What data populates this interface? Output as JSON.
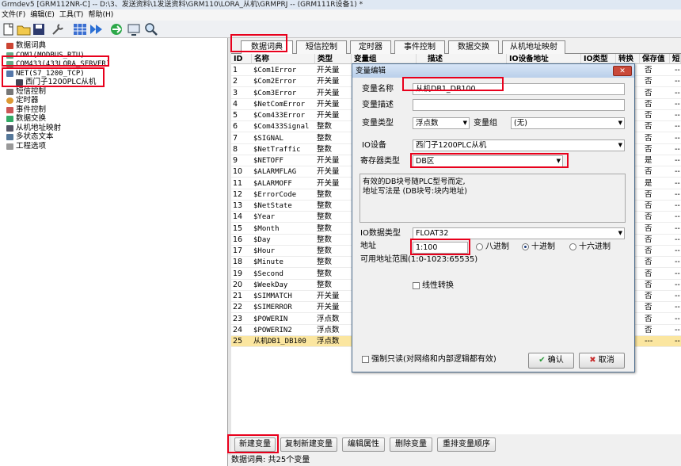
{
  "window": {
    "title": "Grmdev5 [GRM112NR-C]  -- D:\\3、发送资料\\1发送资料\\GRM110\\LORA_从机\\GRMPRJ -- (GRM111R设备1) *"
  },
  "menu": [
    "文件(F)",
    "编辑(E)",
    "工具(T)",
    "帮助(H)"
  ],
  "toolbar_icons": [
    "new-icon",
    "open-icon",
    "save-icon",
    "wrench-icon",
    "grid-icon",
    "download-icon",
    "upload-icon",
    "monitor-icon",
    "search-icon"
  ],
  "tree": {
    "items": [
      {
        "label": "数据词典",
        "icon": "book-icon"
      },
      {
        "label": "COM1(MODBUS_RTU)",
        "icon": "port-icon"
      },
      {
        "label": "COM433(433LORA_SERVER)",
        "icon": "port-icon"
      },
      {
        "label": "NET(S7_1200_TCP)",
        "icon": "network-icon"
      },
      {
        "label": "西门子1200PLC从机",
        "icon": "device-icon"
      },
      {
        "label": "短信控制",
        "icon": "sms-icon"
      },
      {
        "label": "定时器",
        "icon": "clock-icon"
      },
      {
        "label": "事件控制",
        "icon": "event-icon"
      },
      {
        "label": "数据交换",
        "icon": "exchange-icon"
      },
      {
        "label": "从机地址映射",
        "icon": "map-icon"
      },
      {
        "label": "多状态文本",
        "icon": "text-icon"
      },
      {
        "label": "工程选项",
        "icon": "options-icon"
      }
    ]
  },
  "tabs": [
    {
      "label": "数据词典",
      "active": true
    },
    {
      "label": "短信控制"
    },
    {
      "label": "定时器"
    },
    {
      "label": "事件控制"
    },
    {
      "label": "数据交换"
    },
    {
      "label": "从机地址映射"
    }
  ],
  "grid": {
    "headers": [
      "ID",
      "名称",
      "类型",
      "变量组",
      "描述",
      "IO设备地址",
      "IO类型",
      "转换",
      "保存值",
      "短"
    ],
    "rows": [
      {
        "id": "1",
        "name": "$Com1Error",
        "type": "开关量",
        "save": "否",
        "tail": "--"
      },
      {
        "id": "2",
        "name": "$Com2Error",
        "type": "开关量",
        "save": "否",
        "tail": "--"
      },
      {
        "id": "3",
        "name": "$Com3Error",
        "type": "开关量",
        "save": "否",
        "tail": "--"
      },
      {
        "id": "4",
        "name": "$NetComError",
        "type": "开关量",
        "save": "否",
        "tail": "--"
      },
      {
        "id": "5",
        "name": "$Com433Error",
        "type": "开关量",
        "save": "否",
        "tail": "--"
      },
      {
        "id": "6",
        "name": "$Com433Signal",
        "type": "整数",
        "save": "否",
        "tail": "--"
      },
      {
        "id": "7",
        "name": "$SIGNAL",
        "type": "整数",
        "save": "否",
        "tail": "--"
      },
      {
        "id": "8",
        "name": "$NetTraffic",
        "type": "整数",
        "save": "否",
        "tail": "--"
      },
      {
        "id": "9",
        "name": "$NETOFF",
        "type": "开关量",
        "save": "是",
        "tail": "--"
      },
      {
        "id": "10",
        "name": "$ALARMFLAG",
        "type": "开关量",
        "save": "否",
        "tail": "--"
      },
      {
        "id": "11",
        "name": "$ALARMOFF",
        "type": "开关量",
        "save": "是",
        "tail": "--"
      },
      {
        "id": "12",
        "name": "$ErrorCode",
        "type": "整数",
        "save": "否",
        "tail": "--"
      },
      {
        "id": "13",
        "name": "$NetState",
        "type": "整数",
        "save": "否",
        "tail": "--"
      },
      {
        "id": "14",
        "name": "$Year",
        "type": "整数",
        "save": "否",
        "tail": "--"
      },
      {
        "id": "15",
        "name": "$Month",
        "type": "整数",
        "save": "否",
        "tail": "--"
      },
      {
        "id": "16",
        "name": "$Day",
        "type": "整数",
        "save": "否",
        "tail": "--"
      },
      {
        "id": "17",
        "name": "$Hour",
        "type": "整数",
        "save": "否",
        "tail": "--"
      },
      {
        "id": "18",
        "name": "$Minute",
        "type": "整数",
        "save": "否",
        "tail": "--"
      },
      {
        "id": "19",
        "name": "$Second",
        "type": "整数",
        "save": "否",
        "tail": "--"
      },
      {
        "id": "20",
        "name": "$WeekDay",
        "type": "整数",
        "save": "否",
        "tail": "--"
      },
      {
        "id": "21",
        "name": "$SIMMATCH",
        "type": "开关量",
        "save": "否",
        "tail": "--"
      },
      {
        "id": "22",
        "name": "$SIMERROR",
        "type": "开关量",
        "save": "否",
        "tail": "--"
      },
      {
        "id": "23",
        "name": "$POWERIN",
        "type": "浮点数",
        "save": "否",
        "tail": "--"
      },
      {
        "id": "24",
        "name": "$POWERIN2",
        "type": "浮点数",
        "save": "否",
        "tail": "--"
      },
      {
        "id": "25",
        "name": "从机DB1_DB100",
        "type": "浮点数",
        "save": "---",
        "tail": "--"
      }
    ]
  },
  "buttons": [
    "新建变量",
    "复制新建变量",
    "编辑属性",
    "删除变量",
    "重排变量顺序"
  ],
  "status": "数据词典: 共25个变量",
  "dialog": {
    "title": "变量编辑",
    "close": "✕",
    "var_name_label": "变量名称",
    "var_name": "从机DB1_DB100",
    "var_desc_label": "变量描述",
    "var_desc": "",
    "var_type_label": "变量类型",
    "var_type": "浮点数",
    "var_group_label": "变量组",
    "var_group": "(无)",
    "io_device_label": "IO设备",
    "io_device": "西门子1200PLC从机",
    "reg_type_label": "寄存器类型",
    "reg_type": "DB区",
    "info_line1": "有效的DB块号随PLC型号而定,",
    "info_line2": "地址写法是 (DB块号:块内地址)",
    "io_data_type_label": "IO数据类型",
    "io_data_type": "FLOAT32",
    "address_label": "地址",
    "address": "1:100",
    "radio_oct": "八进制",
    "radio_dec": "十进制",
    "radio_hex": "十六进制",
    "range_text": "可用地址范围(1:0-1023:65535)",
    "linear_label": "线性转换",
    "readonly_label": "强制只读(对网络和内部逻辑都有效)",
    "ok": "确认",
    "cancel": "取消"
  },
  "colors": {
    "highlight": "#e8001c",
    "selected_row": "#fbe6a0",
    "dialog_title": "#c9dcf2"
  }
}
